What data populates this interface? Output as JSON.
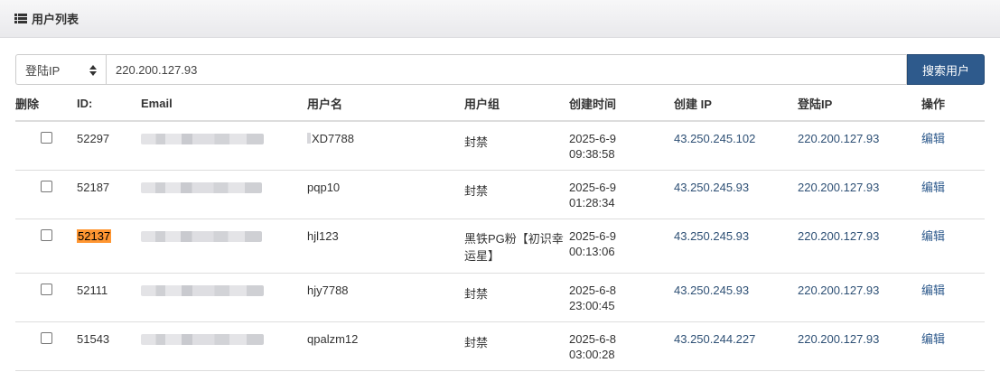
{
  "panel": {
    "title": "用户列表",
    "icon": "list-icon"
  },
  "search": {
    "field_selected": "登陆IP",
    "query": "220.200.127.93",
    "button_label": "搜索用户"
  },
  "table": {
    "headers": [
      "删除",
      "ID:",
      "Email",
      "用户名",
      "用户组",
      "创建时间",
      "创建 IP",
      "登陆IP",
      "操作"
    ],
    "rows": [
      {
        "id": "52297",
        "email": "",
        "username": "XD7788",
        "group": "封禁",
        "created_date": "2025-6-9",
        "created_time": "09:38:58",
        "create_ip": "43.250.245.102",
        "login_ip": "220.200.127.93",
        "action": "编辑"
      },
      {
        "id": "52187",
        "email": "",
        "username": "pqp10",
        "group": "封禁",
        "created_date": "2025-6-9",
        "created_time": "01:28:34",
        "create_ip": "43.250.245.93",
        "login_ip": "220.200.127.93",
        "action": "编辑"
      },
      {
        "id": "52137",
        "email": "",
        "username": "hjl123",
        "group": "黑铁PG粉【初识幸运星】",
        "created_date": "2025-6-9",
        "created_time": "00:13:06",
        "create_ip": "43.250.245.93",
        "login_ip": "220.200.127.93",
        "action": "编辑"
      },
      {
        "id": "52111",
        "email": "",
        "username": "hjy7788",
        "group": "封禁",
        "created_date": "2025-6-8",
        "created_time": "23:00:45",
        "create_ip": "43.250.245.93",
        "login_ip": "220.200.127.93",
        "action": "编辑"
      },
      {
        "id": "51543",
        "email": "",
        "username": "qpalzm12",
        "group": "封禁",
        "created_date": "2025-6-8",
        "created_time": "03:00:28",
        "create_ip": "43.250.244.227",
        "login_ip": "220.200.127.93",
        "action": "编辑"
      }
    ]
  },
  "colors": {
    "accent": "#2e5a8c",
    "highlight": "#ff9632",
    "ip_text": "#2e5075"
  }
}
